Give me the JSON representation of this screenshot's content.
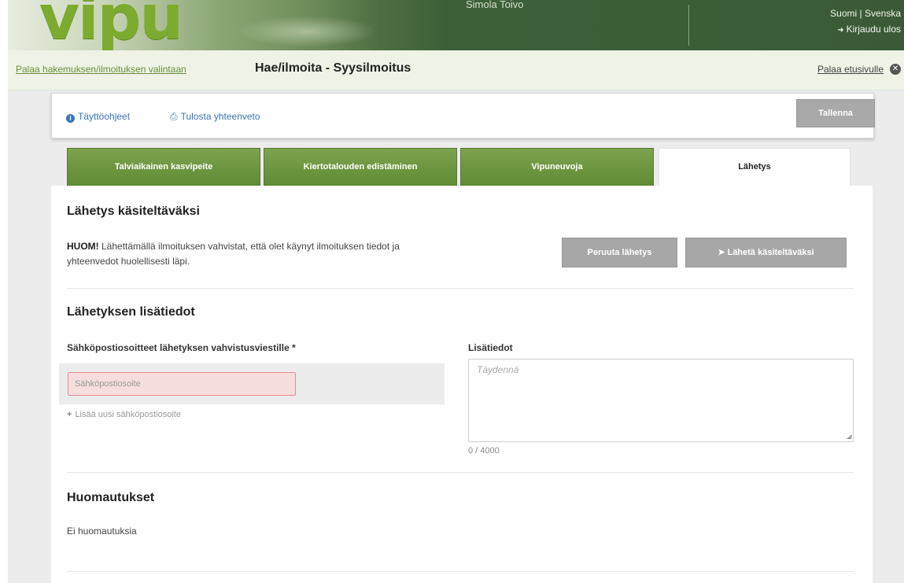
{
  "header": {
    "logo": "vipu",
    "username": "Simola Toivo",
    "languages": "Suomi | Svenska",
    "logout_label": "Kirjaudu ulos"
  },
  "subnav": {
    "back_link": "Palaa hakemuksen/ilmoituksen valintaan",
    "title": "Hae/ilmoita - Syysilmoitus",
    "home_link": "Palaa etusivulle"
  },
  "toolbar": {
    "help_label": "Täyttöohjeet",
    "print_label": "Tulosta yhteenveto",
    "save_label": "Tallenna"
  },
  "tabs": [
    {
      "label": "Talviaikainen kasvipeite",
      "active": false
    },
    {
      "label": "Kiertotalouden edistäminen",
      "active": false
    },
    {
      "label": "Vipuneuvoja",
      "active": false
    },
    {
      "label": "Lähetys",
      "active": true
    }
  ],
  "send_section": {
    "heading": "Lähetys käsiteltäväksi",
    "note_bold": "HUOM!",
    "note_text": " Lähettämällä ilmoituksen vahvistat, että olet käynyt ilmoituksen tiedot ja yhteenvedot huolellisesti läpi.",
    "cancel_label": "Peruuta lähetys",
    "send_label": "Lähetä käsiteltäväksi"
  },
  "extra_section": {
    "heading": "Lähetyksen lisätiedot",
    "email_label": "Sähköpostiosoitteet lähetyksen vahvistusviestille *",
    "email_placeholder": "Sähköpostiosoite",
    "add_email_label": "Lisää uusi sähköpostiosoite",
    "info_label": "Lisätiedot",
    "info_placeholder": "Täydennä",
    "counter": "0 / 4000"
  },
  "remarks_section": {
    "heading": "Huomautukset",
    "text": "Ei huomautuksia"
  },
  "colors": {
    "header_green": "#3b5e37",
    "tab_green": "#6b9640",
    "link_blue": "#3a73b8",
    "error_pink": "#f7dede"
  }
}
